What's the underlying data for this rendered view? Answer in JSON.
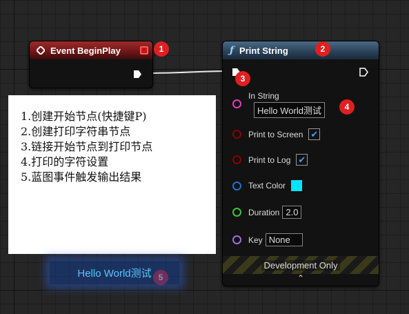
{
  "event_node": {
    "title": "Event BeginPlay",
    "header_color": "#9e2a2a",
    "icon": "event-diamond-icon"
  },
  "print_node": {
    "title": "Print String",
    "header_color": "#2b435a",
    "icon": "function-icon",
    "pins": {
      "in_string": {
        "label": "In String",
        "value": "Hello World测试",
        "color": "#e040c0"
      },
      "print_to_screen": {
        "label": "Print to Screen",
        "checked": true,
        "color": "#8b0000"
      },
      "print_to_log": {
        "label": "Print to Log",
        "checked": true,
        "color": "#8b0000"
      },
      "text_color": {
        "label": "Text Color",
        "value": "#00e5ff",
        "color": "#1f6fd0"
      },
      "duration": {
        "label": "Duration",
        "value": "2.0",
        "color": "#3cc43c"
      },
      "key": {
        "label": "Key",
        "value": "None",
        "color": "#a070e0"
      }
    },
    "footer": "Development Only",
    "check_mark": "✔",
    "collapse_glyph": "⌃"
  },
  "badges": [
    "1",
    "2",
    "3",
    "4",
    "5"
  ],
  "notes": [
    "1.创建开始节点(快捷键P)",
    "2.创建打印字符串节点",
    "3.链接开始节点到打印节点",
    "4.打印的字符设置",
    "5.蓝图事件触发输出结果"
  ],
  "output_text": "Hello World测试"
}
